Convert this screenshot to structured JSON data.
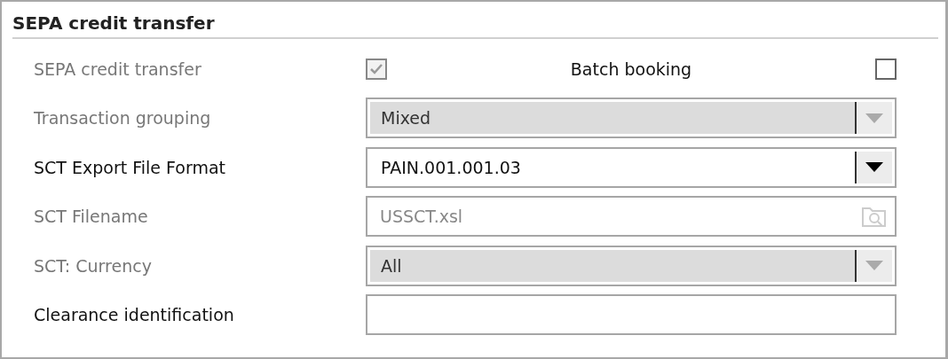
{
  "section": {
    "title": "SEPA credit transfer"
  },
  "rows": [
    {
      "kind": "checkbox-pair",
      "label": "SEPA credit transfer",
      "disabled": true,
      "checked": true,
      "extra": {
        "label": "Batch booking",
        "checked": false,
        "disabled": false
      }
    },
    {
      "kind": "select",
      "label": "Transaction grouping",
      "disabled": true,
      "value": "Mixed"
    },
    {
      "kind": "select",
      "label": "SCT Export File Format",
      "disabled": false,
      "value": "PAIN.001.001.03"
    },
    {
      "kind": "file",
      "label": "SCT Filename",
      "disabled": true,
      "value": "USSCT.xsl"
    },
    {
      "kind": "select",
      "label": "SCT: Currency",
      "disabled": true,
      "value": "All"
    },
    {
      "kind": "text",
      "label": "Clearance identification",
      "disabled": false
    }
  ]
}
